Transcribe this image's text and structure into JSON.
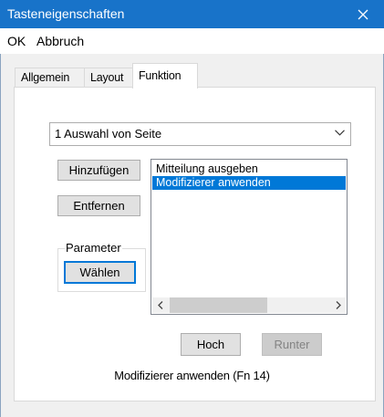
{
  "window": {
    "title": "Tasteneigenschaften",
    "close_glyph": "✕"
  },
  "menu": {
    "items": [
      {
        "label": "OK"
      },
      {
        "label": "Abbruch"
      }
    ]
  },
  "tabs": [
    {
      "label": "Allgemein",
      "active": false
    },
    {
      "label": "Layout",
      "active": false
    },
    {
      "label": "Funktion",
      "active": true
    }
  ],
  "funktion": {
    "dropdown": {
      "selected": "1 Auswahl von Seite",
      "icon": "chevron-down-icon"
    },
    "add_button": "Hinzufügen",
    "remove_button": "Entfernen",
    "parameter_group": {
      "label": "Parameter",
      "select_button": "Wählen"
    },
    "list": {
      "items": [
        {
          "label": "Mitteilung ausgeben",
          "selected": false
        },
        {
          "label": "Modifizierer anwenden",
          "selected": true
        }
      ],
      "scroll_left_glyph": "‹",
      "scroll_right_glyph": "›"
    },
    "up_button": "Hoch",
    "down_button": "Runter",
    "status_text": "Modifizierer anwenden (Fn 14)"
  },
  "colors": {
    "titlebar": "#1873c9",
    "selection": "#0078d7",
    "background": "#f0f0f0"
  }
}
